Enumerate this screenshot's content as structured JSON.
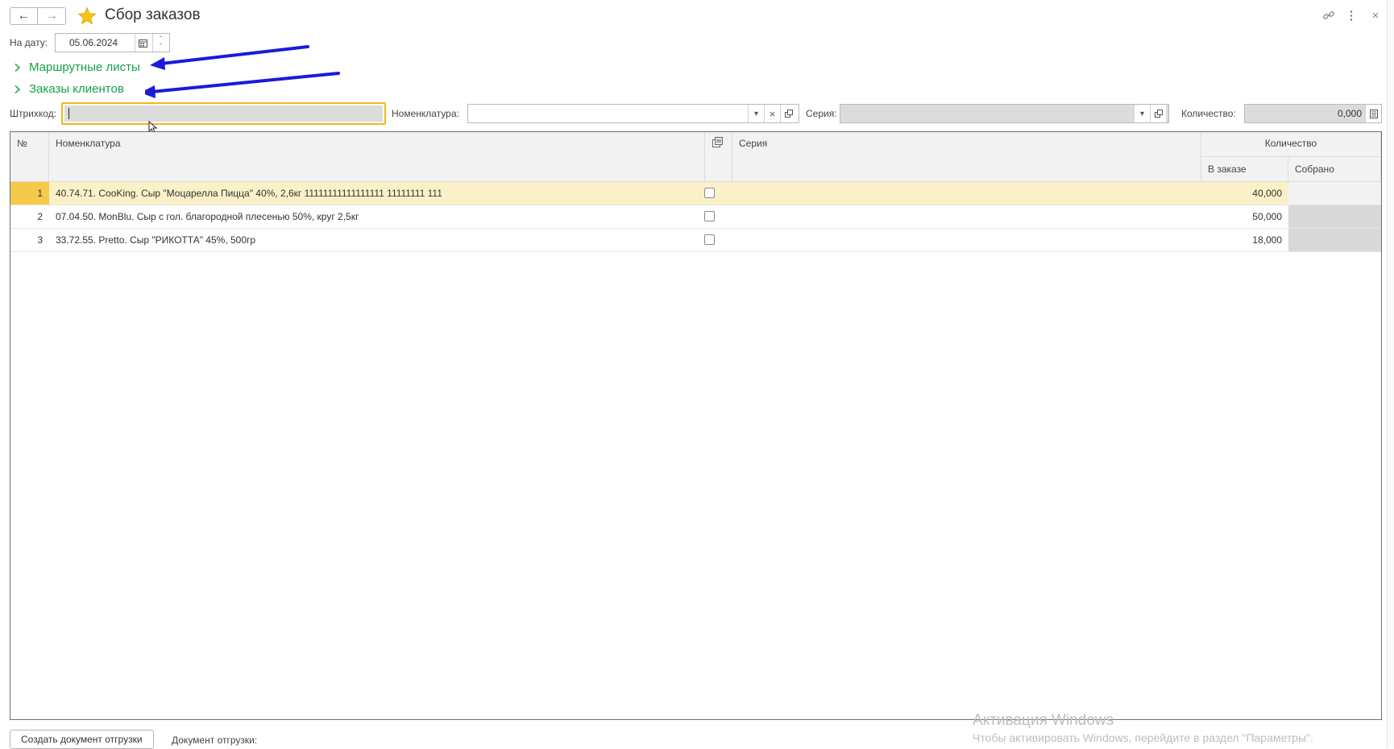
{
  "window": {
    "title": "Сбор заказов"
  },
  "date_filter": {
    "label": "На дату:",
    "value": "05.06.2024"
  },
  "groups": [
    {
      "label": "Маршрутные листы"
    },
    {
      "label": "Заказы клиентов"
    }
  ],
  "filters": {
    "barcode_label": "Штрихкод:",
    "barcode_value": "",
    "nomenclature_label": "Номенклатура:",
    "nomenclature_value": "",
    "series_label": "Серия:",
    "series_value": "",
    "quantity_label": "Количество:",
    "quantity_value": "0,000"
  },
  "table": {
    "headers": {
      "number": "№",
      "nomenclature": "Номенклатура",
      "series": "Серия",
      "quantity": "Количество",
      "in_order": "В заказе",
      "collected": "Собрано"
    },
    "rows": [
      {
        "num": "1",
        "name": "40.74.71. CooKing. Сыр \"Моцарелла Пицца\" 40%, 2,6кг 11111111111111111 11111111 111",
        "series": "",
        "in_order": "40,000",
        "collected": "",
        "checked": false
      },
      {
        "num": "2",
        "name": "07.04.50. MonBlu. Сыр с гол. благородной плесенью 50%, круг 2,5кг",
        "series": "",
        "in_order": "50,000",
        "collected": "",
        "checked": false
      },
      {
        "num": "3",
        "name": "33.72.55. Pretto. Сыр \"РИКОТТА\" 45%, 500гр",
        "series": "",
        "in_order": "18,000",
        "collected": "",
        "checked": false
      }
    ]
  },
  "footer": {
    "create_button": "Создать документ отгрузки",
    "shipment_doc_label": "Документ отгрузки:"
  },
  "watermark": {
    "title": "Активация Windows",
    "subtitle": "Чтобы активировать Windows, перейдите в раздел \"Параметры\"."
  },
  "colors": {
    "accent_green": "#15a14a",
    "selected_row": "#fbf1c8",
    "focus_border": "#f2b51f",
    "annotation_arrow": "#1a1adb"
  }
}
